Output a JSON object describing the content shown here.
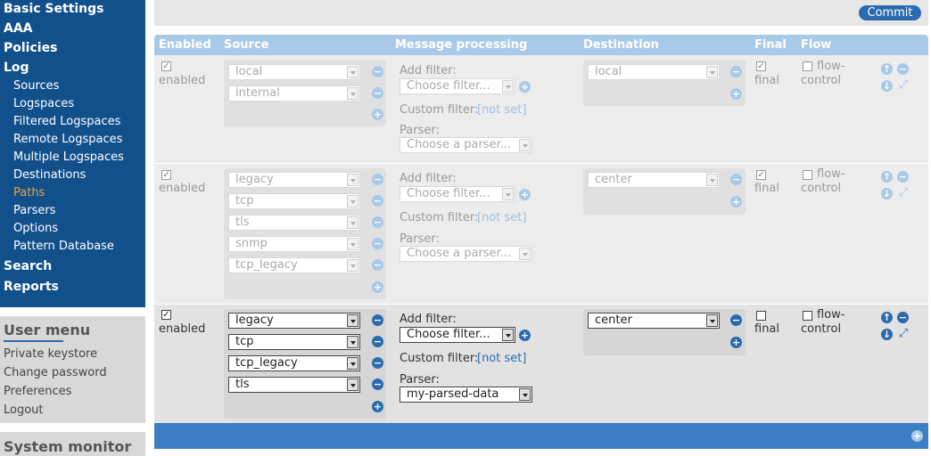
{
  "sidebar": {
    "top_items": [
      "Basic Settings",
      "AAA",
      "Policies",
      "Log"
    ],
    "log_sub": [
      "Sources",
      "Logspaces",
      "Filtered Logspaces",
      "Remote Logspaces",
      "Multiple Logspaces",
      "Destinations",
      "Paths",
      "Parsers",
      "Options",
      "Pattern Database"
    ],
    "active_sub": "Paths",
    "bottom_items": [
      "Search",
      "Reports"
    ],
    "user_menu": {
      "title": "User menu",
      "items": [
        "Private keystore",
        "Change password",
        "Preferences",
        "Logout"
      ]
    },
    "system_monitor": {
      "title": "System monitor"
    }
  },
  "toolbar": {
    "commit_label": "Commit"
  },
  "table": {
    "headers": [
      "Enabled",
      "Source",
      "Message processing",
      "Destination",
      "Final",
      "Flow"
    ],
    "labels": {
      "enabled": "enabled",
      "add_filter": "Add filter:",
      "choose_filter": "Choose filter...",
      "custom_filter": "Custom filter:",
      "not_set": "[not set]",
      "parser": "Parser:",
      "final": "final",
      "flow": "flow-",
      "control": "control"
    },
    "rows": [
      {
        "state": "disabled",
        "enabled": true,
        "sources": [
          "local",
          "internal"
        ],
        "parser": "Choose a parser...",
        "destinations": [
          "local"
        ],
        "final": true,
        "flow_control": false
      },
      {
        "state": "disabled",
        "enabled": true,
        "sources": [
          "legacy",
          "tcp",
          "tls",
          "snmp",
          "tcp_legacy"
        ],
        "parser": "Choose a parser...",
        "destinations": [
          "center"
        ],
        "final": true,
        "flow_control": false
      },
      {
        "state": "enabled",
        "enabled": true,
        "sources": [
          "legacy",
          "tcp",
          "tcp_legacy",
          "tls"
        ],
        "parser": "my-parsed-data",
        "destinations": [
          "center"
        ],
        "final": false,
        "flow_control": false
      }
    ]
  },
  "icons": {
    "remove": "minus-circle-icon",
    "add": "plus-circle-icon",
    "up": "arrow-up-circle-icon",
    "down": "arrow-down-circle-icon",
    "expand": "expand-icon",
    "check": "checkmark-icon"
  },
  "colors": {
    "nav_bg": "#12508c",
    "accent": "#2a6bb0",
    "active": "#e8a33d",
    "header_bg": "#a9c9e9",
    "footer_bg": "#3a7fc4"
  }
}
